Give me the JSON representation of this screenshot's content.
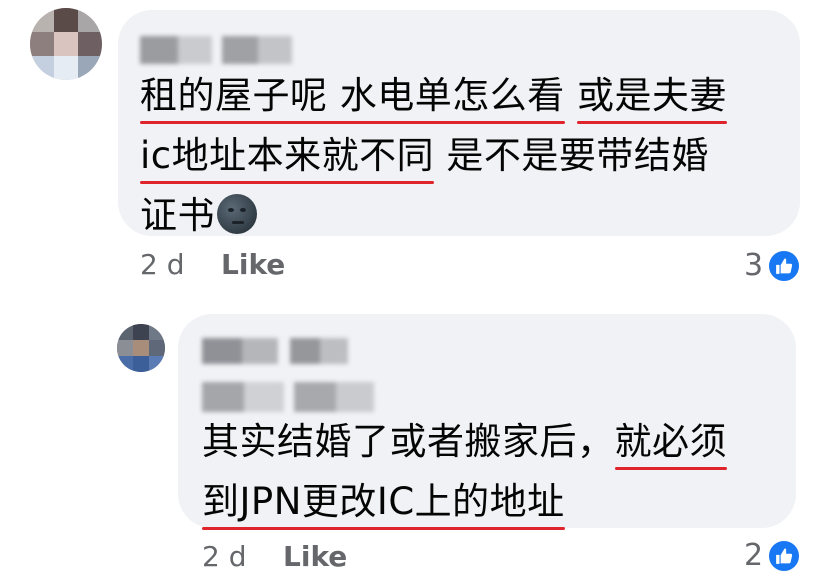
{
  "comment": {
    "author": "Qing Qing",
    "lines": [
      [
        {
          "t": "租的屋子呢 水电单怎么看",
          "u": true
        },
        {
          "t": " "
        },
        {
          "t": "或是夫妻",
          "u": true
        }
      ],
      [
        {
          "t": "ic地址本来就不同",
          "u": true
        },
        {
          "t": " 是不是要带结婚"
        }
      ],
      [
        {
          "t": "证书"
        }
      ]
    ],
    "time": "2 d",
    "like_label": "Like",
    "reaction_count": "3"
  },
  "reply": {
    "author": "Renee Lai",
    "mention": "Qing Qing",
    "lines": [
      [
        {
          "t": "其实结婚了或者搬家后，"
        },
        {
          "t": "就必须",
          "u": true
        }
      ],
      [
        {
          "t": "到JPN更改IC上的地址",
          "u": true
        }
      ]
    ],
    "time": "2 d",
    "like_label": "Like",
    "reaction_count": "2"
  },
  "icons": {
    "reaction": "thumbs-up-icon",
    "emoji": "new-moon-face-emoji"
  },
  "colors": {
    "bubble": "#f0f2f5",
    "underline": "#e0242b",
    "like_blue": "#1877f2",
    "meta_gray": "#65676b"
  }
}
